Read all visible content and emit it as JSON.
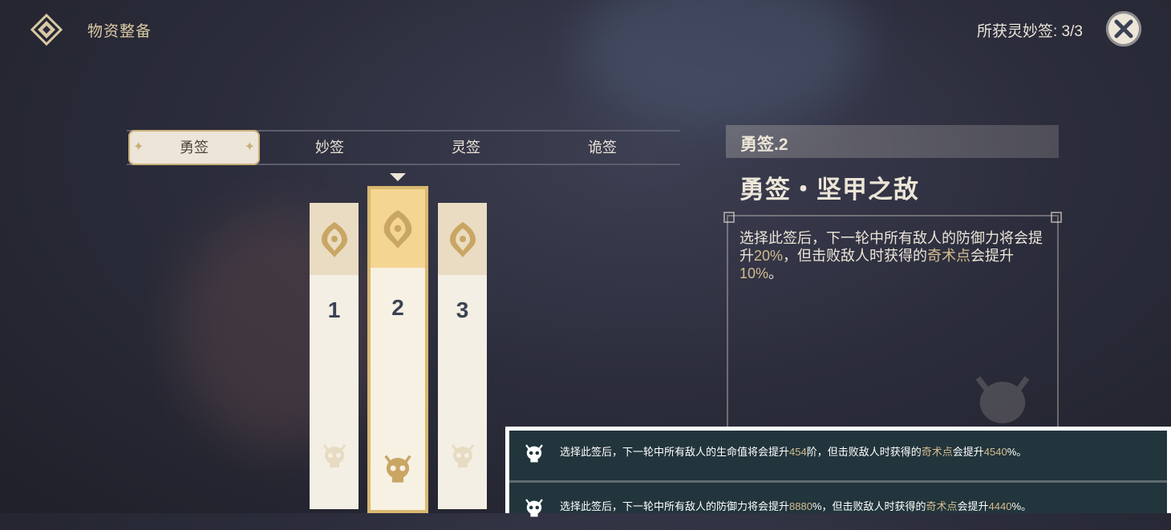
{
  "header": {
    "title": "物资整备",
    "counter": "所获灵妙签: 3/3"
  },
  "tabs": [
    {
      "label": "勇签",
      "active": true
    },
    {
      "label": "妙签",
      "active": false
    },
    {
      "label": "灵签",
      "active": false
    },
    {
      "label": "诡签",
      "active": false
    }
  ],
  "cards": [
    {
      "number": "1",
      "selected": false
    },
    {
      "number": "2",
      "selected": true
    },
    {
      "number": "3",
      "selected": false
    }
  ],
  "detail": {
    "level_label": "勇签.2",
    "name": "勇签・坚甲之敌",
    "desc_1": "选择此签后，下一轮中所有敌人的防御力将会提升",
    "desc_val1": "20%",
    "desc_2": "，但击败敌人时获得的",
    "desc_kw": "奇术点",
    "desc_3": "会提升",
    "desc_val2": "10%",
    "desc_4": "。"
  },
  "popup": {
    "rows": [
      {
        "t1": "选择此签后，下一轮中所有敌人的生命值将会提升",
        "v1": "454",
        "t2": "阶，但击败敌人时获得的",
        "kw": "奇术点",
        "t3": "会提升",
        "v2": "4540",
        "t4": "%。"
      },
      {
        "t1": "选择此签后，下一轮中所有敌人的防御力将会提升",
        "v1": "8880",
        "t2": "%，但击败敌人时获得的",
        "kw": "奇术点",
        "t3": "会提升",
        "v2": "4440",
        "t4": "%。"
      }
    ]
  },
  "colors": {
    "accent_gold": "#d3bc8e",
    "card_selected_border": "#d9b870",
    "popup_bg": "#22353c"
  },
  "icons": [
    "emblem-icon",
    "close-icon",
    "skull-icon",
    "sparkle-icon"
  ]
}
